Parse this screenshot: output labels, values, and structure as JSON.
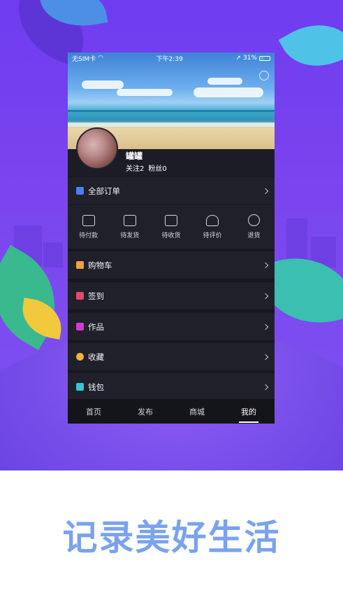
{
  "status_bar": {
    "carrier": "无SIM卡",
    "time": "下午2:39",
    "battery": "31%"
  },
  "profile": {
    "username": "罐罐",
    "following": "关注2",
    "fans": "粉丝0"
  },
  "orders": {
    "label": "全部订单",
    "items": [
      {
        "label": "待付款",
        "icon": "wallet-icon"
      },
      {
        "label": "待发货",
        "icon": "package-icon"
      },
      {
        "label": "待收货",
        "icon": "truck-icon"
      },
      {
        "label": "待评价",
        "icon": "review-icon"
      },
      {
        "label": "退货",
        "icon": "return-icon"
      }
    ]
  },
  "menu": [
    {
      "label": "购物车",
      "icon": "cart-icon",
      "color": "#f0a040"
    },
    {
      "label": "签到",
      "icon": "calendar-icon",
      "color": "#e24a6a"
    },
    {
      "label": "作品",
      "icon": "folder-icon",
      "color": "#d63ad0"
    },
    {
      "label": "收藏",
      "icon": "star-icon",
      "color": "#f0b23a"
    },
    {
      "label": "钱包",
      "icon": "wallet-icon",
      "color": "#39c6d6"
    }
  ],
  "tabs": [
    {
      "label": "首页"
    },
    {
      "label": "发布"
    },
    {
      "label": "商城"
    },
    {
      "label": "我的",
      "active": true
    }
  ],
  "tagline": "记录美好生活",
  "colors": {
    "background": "#7444ee",
    "tagline": "#7aa2ee",
    "phone_bg": "#17171f"
  }
}
